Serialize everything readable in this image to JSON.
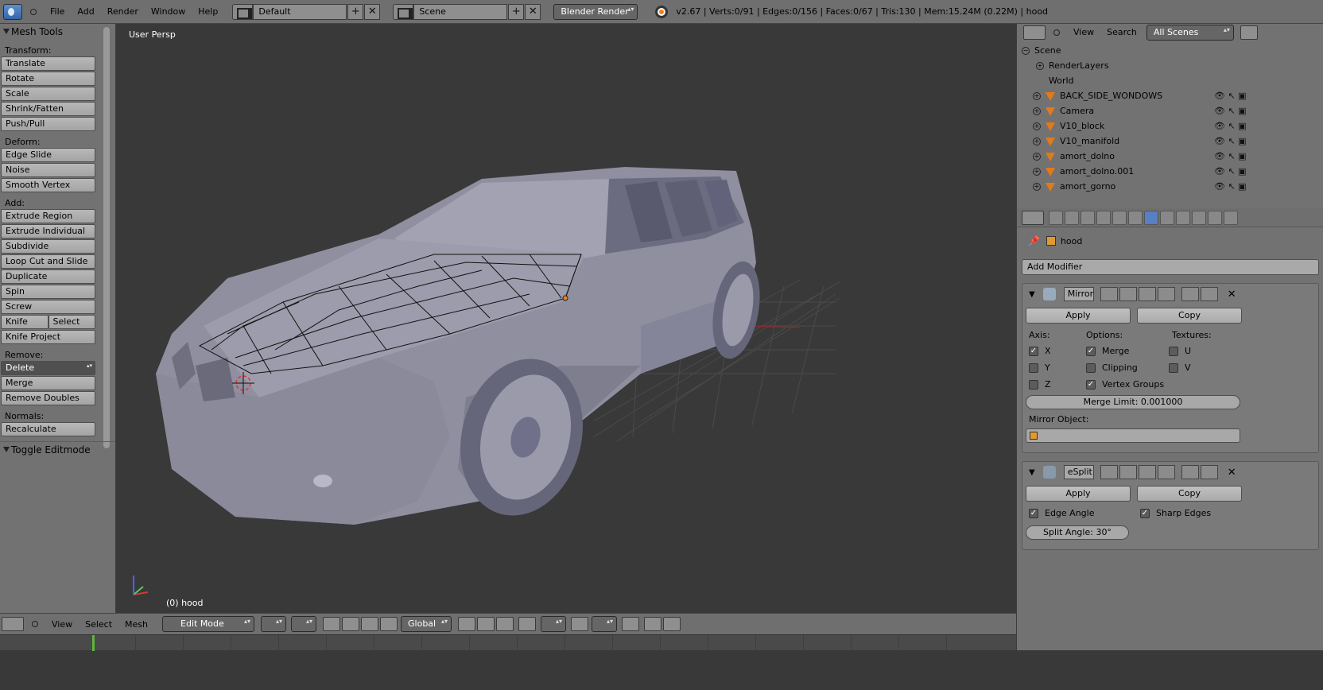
{
  "topbar": {
    "menus": [
      "File",
      "Add",
      "Render",
      "Window",
      "Help"
    ],
    "layout": "Default",
    "scene": "Scene",
    "engine": "Blender Render",
    "status": "v2.67 | Verts:0/91 | Edges:0/156 | Faces:0/67 | Tris:130 | Mem:15.24M (0.22M) | hood"
  },
  "toolshelf": {
    "title": "Mesh Tools",
    "transform_label": "Transform:",
    "transform": [
      "Translate",
      "Rotate",
      "Scale",
      "Shrink/Fatten",
      "Push/Pull"
    ],
    "deform_label": "Deform:",
    "deform": [
      "Edge Slide",
      "Noise",
      "Smooth Vertex"
    ],
    "add_label": "Add:",
    "add": [
      "Extrude Region",
      "Extrude Individual",
      "Subdivide",
      "Loop Cut and Slide",
      "Duplicate",
      "Spin",
      "Screw"
    ],
    "knife": "Knife",
    "select": "Select",
    "knife_project": "Knife Project",
    "remove_label": "Remove:",
    "delete": "Delete",
    "remove": [
      "Merge",
      "Remove Doubles"
    ],
    "normals_label": "Normals:",
    "recalculate": "Recalculate",
    "toggle_editmode": "Toggle Editmode"
  },
  "viewport": {
    "view_label": "User Persp",
    "object_label": "(0) hood"
  },
  "viewport_header": {
    "menus": [
      "View",
      "Select",
      "Mesh"
    ],
    "mode": "Edit Mode",
    "orientation": "Global"
  },
  "outliner": {
    "menus": [
      "View",
      "Search"
    ],
    "scenes_filter": "All Scenes",
    "rows": [
      "Scene",
      "RenderLayers",
      "World",
      "BACK_SIDE_WONDOWS",
      "Camera",
      "V10_block",
      "V10_manifold",
      "amort_dolno",
      "amort_dolno.001",
      "amort_gorno"
    ]
  },
  "properties": {
    "breadcrumb": "hood",
    "add_modifier": "Add Modifier",
    "mirror": {
      "name": "Mirror",
      "apply": "Apply",
      "copy": "Copy",
      "axis_label": "Axis:",
      "options_label": "Options:",
      "textures_label": "Textures:",
      "axis": [
        {
          "label": "X",
          "checked": true
        },
        {
          "label": "Y",
          "checked": false
        },
        {
          "label": "Z",
          "checked": false
        }
      ],
      "options": [
        {
          "label": "Merge",
          "checked": true
        },
        {
          "label": "Clipping",
          "checked": false
        },
        {
          "label": "Vertex Groups",
          "checked": true
        }
      ],
      "textures": [
        {
          "label": "U",
          "checked": false
        },
        {
          "label": "V",
          "checked": false
        }
      ],
      "merge_limit": "Merge Limit: 0.001000",
      "mirror_object_label": "Mirror Object:"
    },
    "esplit": {
      "name": "eSplit",
      "apply": "Apply",
      "copy": "Copy",
      "edge_angle": "Edge Angle",
      "sharp_edges": "Sharp Edges",
      "split_angle": "Split Angle: 30°"
    }
  }
}
